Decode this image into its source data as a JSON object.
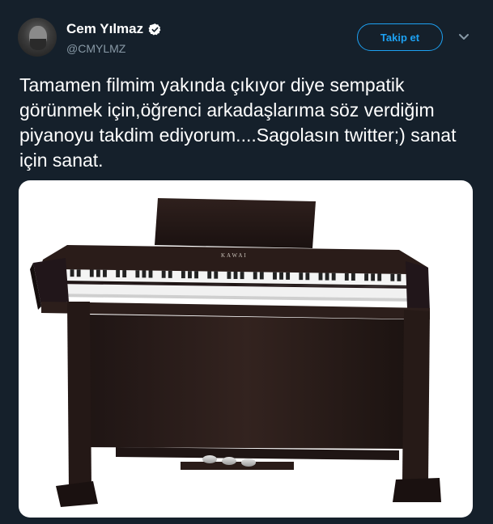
{
  "author": {
    "display_name": "Cem Yılmaz",
    "handle": "@CMYLMZ",
    "verified": true,
    "avatar_icon": "avatar-photo"
  },
  "actions": {
    "follow_label": "Takip et",
    "menu_icon": "chevron-down-icon"
  },
  "tweet": {
    "text": "Tamamen filmim yakında çıkıyor diye sempatik görünmek için,öğrenci arkadaşlarıma söz verdiğim piyanoyu takdim ediyorum....Sagolasın twitter;) sanat için sanat."
  },
  "media": {
    "brand_text": "KAWAI"
  },
  "colors": {
    "background": "#15202b",
    "accent": "#1da1f2",
    "secondary_text": "#8899a6",
    "piano_wood": "#2b1d1b"
  }
}
